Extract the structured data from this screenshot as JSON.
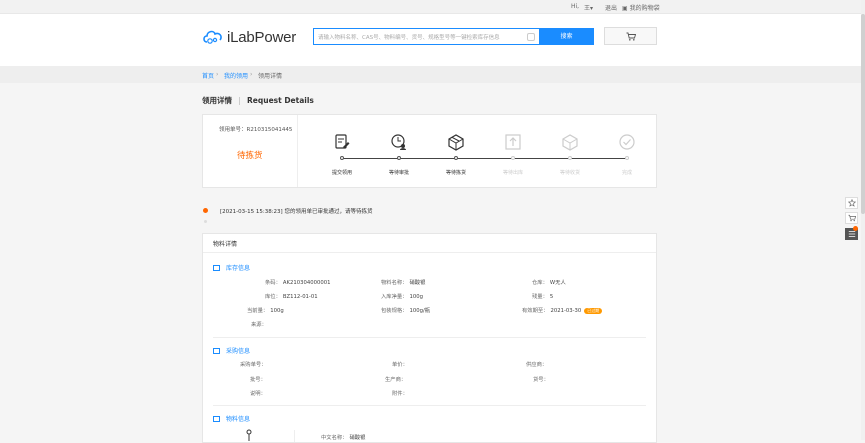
{
  "topbar": {
    "greeting": "Hi,",
    "user": "王",
    "logout": "退出",
    "cart_label": "我的购物袋"
  },
  "header": {
    "logo_text": "iLabPower",
    "search_placeholder": "请输入物料名称、CAS号、物料编号、货号、规格型号等一键检索库存信息",
    "search_button": "搜索"
  },
  "breadcrumb": {
    "home": "首页",
    "my_requests": "我的领用",
    "current": "领用详情"
  },
  "page": {
    "title_cn": "领用详情",
    "title_en": "Request Details"
  },
  "status": {
    "req_no_label": "领用单号：",
    "req_no": "R210315041445",
    "state": "待拣货",
    "steps": [
      {
        "label": "提交领用",
        "done": true
      },
      {
        "label": "等待审批",
        "done": true
      },
      {
        "label": "等待拣货",
        "done": true
      },
      {
        "label": "等待出库",
        "done": false
      },
      {
        "label": "等待收货",
        "done": false
      },
      {
        "label": "完成",
        "done": false
      }
    ]
  },
  "log": {
    "entry": "[2021-03-15 15:38:23] 您的领用单已审批通过，请等待拣货"
  },
  "detail": {
    "header": "物料详情",
    "stock": {
      "title": "库存信息",
      "barcode_label": "条码：",
      "barcode": "AK210304000001",
      "name_label": "物料名称：",
      "name": "硝酸银",
      "warehouse_label": "仓库：",
      "warehouse": "W无人",
      "location_label": "库位：",
      "location": "BZ112-01-01",
      "net_label": "入库净量：",
      "net": "100g",
      "split_label": "残量：",
      "split": "5",
      "current_label": "当前量：",
      "current": "100g",
      "pack_label": "包装规格：",
      "pack": "100g/瓶",
      "expiry_label": "有效期至：",
      "expiry": "2021-03-30",
      "expiry_badge": "已过期",
      "source_label": "来源："
    },
    "purchase": {
      "title": "采购信息",
      "order_label": "采购单号：",
      "price_label": "单价：",
      "supplier_label": "供应商：",
      "batch_label": "批号：",
      "maker_label": "生产商：",
      "item_label": "货号：",
      "desc_label": "说明：",
      "attach_label": "附件："
    },
    "material": {
      "title": "物料信息",
      "cn_name_label": "中文名称：",
      "cn_name": "硝酸银"
    }
  }
}
